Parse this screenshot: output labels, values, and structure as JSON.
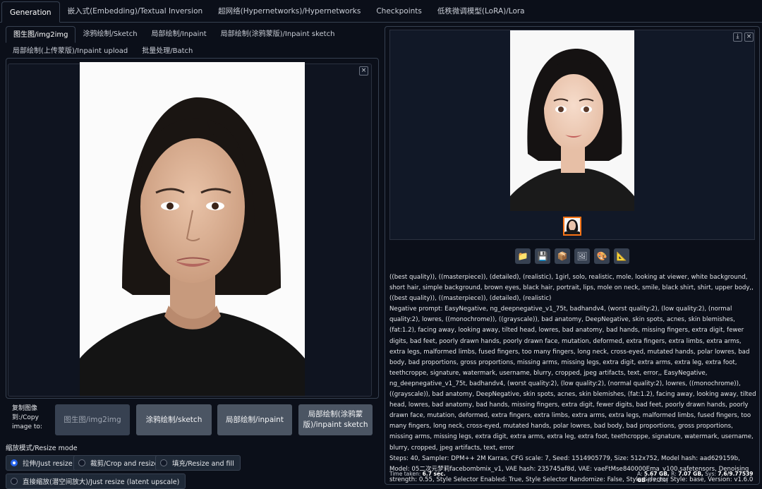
{
  "top_tabs": [
    "Generation",
    "嵌入式(Embedding)/Textual Inversion",
    "超网络(Hypernetworks)/Hypernetworks",
    "Checkpoints",
    "低秩微调模型(LoRA)/Lora"
  ],
  "sub_tabs": [
    "图生图/img2img",
    "涂鸦绘制/Sketch",
    "局部绘制/Inpaint",
    "局部绘制(涂鸦蒙版)/Inpaint sketch",
    "局部绘制(上传蒙版)/Inpaint upload",
    "批量处理/Batch"
  ],
  "close_glyph": "×",
  "download_glyph": "⤓",
  "copy_label": "复制图像到:/Copy image to:",
  "copy_buttons": [
    "图生图/img2img",
    "涂鸦绘制/sketch",
    "局部绘制/inpaint",
    "局部绘制(涂鸦蒙版)/inpaint sketch"
  ],
  "resize_mode_label": "缩放模式/Resize mode",
  "resize_options": [
    "拉伸/Just resize",
    "裁剪/Crop and resize",
    "填充/Resize and fill",
    "直接缩放(潜空间放大)/Just resize (latent upscale)"
  ],
  "resize_selected": "拉伸/Just resize",
  "action_icons": [
    "folder-icon",
    "save-icon",
    "zip-icon",
    "image-icon",
    "palette-icon",
    "ruler-icon"
  ],
  "action_glyphs": [
    "📁",
    "💾",
    "📦",
    "🖼",
    "🎨",
    "📐"
  ],
  "info": {
    "prompt": "((best quality)), ((masterpiece)), (detailed), (realistic), 1girl, solo, realistic, mole, looking at viewer, white background, short hair, simple background, brown eyes, black hair, portrait, lips, mole on neck, smile, black shirt, shirt, upper body,, ((best quality)), ((masterpiece)), (detailed), (realistic)",
    "negative": "Negative prompt: EasyNegative, ng_deepnegative_v1_75t, badhandv4, (worst quality:2), (low quality:2), (normal quality:2), lowres, ((monochrome)), ((grayscale)), bad anatomy, DeepNegative, skin spots, acnes, skin blemishes, (fat:1.2), facing away, looking away, tilted head, lowres, bad anatomy, bad hands, missing fingers, extra digit, fewer digits, bad feet, poorly drawn hands, poorly drawn face, mutation, deformed, extra fingers, extra limbs, extra arms, extra legs, malformed limbs, fused fingers, too many fingers, long neck, cross-eyed, mutated hands, polar lowres, bad body, bad proportions, gross proportions, missing arms, missing legs, extra digit, extra arms, extra leg, extra foot, teethcroppe, signature, watermark, username, blurry, cropped, jpeg artifacts, text, error,, EasyNegative, ng_deepnegative_v1_75t, badhandv4, (worst quality:2), (low quality:2), (normal quality:2), lowres, ((monochrome)), ((grayscale)), bad anatomy, DeepNegative, skin spots, acnes, skin blemishes, (fat:1.2), facing away, looking away, tilted head, lowres, bad anatomy, bad hands, missing fingers, extra digit, fewer digits, bad feet, poorly drawn hands, poorly drawn face, mutation, deformed, extra fingers, extra limbs, extra arms, extra legs, malformed limbs, fused fingers, too many fingers, long neck, cross-eyed, mutated hands, polar lowres, bad body, bad proportions, gross proportions, missing arms, missing legs, extra digit, extra arms, extra leg, extra foot, teethcroppe, signature, watermark, username, blurry, cropped, jpeg artifacts, text, error",
    "params": "Steps: 40, Sampler: DPM++ 2M Karras, CFG scale: 7, Seed: 1514905779, Size: 512x752, Model hash: aad629159b, Model: 05二次元梦莉facebombmix_v1, VAE hash: 235745af8d, VAE: vaeFtMse840000Ema_v100.safetensors, Denoising strength: 0.55, Style Selector Enabled: True, Style Selector Randomize: False, Style Selector Style: base, Version: v1.6.0"
  },
  "footer": {
    "time_label": "Time taken:",
    "time_value": "6.7 sec.",
    "a_label": "A:",
    "a_value": "5.67 GB,",
    "r_label": "R:",
    "r_value": "7.07 GB,",
    "sys_label": "Sys:",
    "sys_value": "7.6/9.77539 GB",
    "sys_pct": "(77.3%)"
  }
}
